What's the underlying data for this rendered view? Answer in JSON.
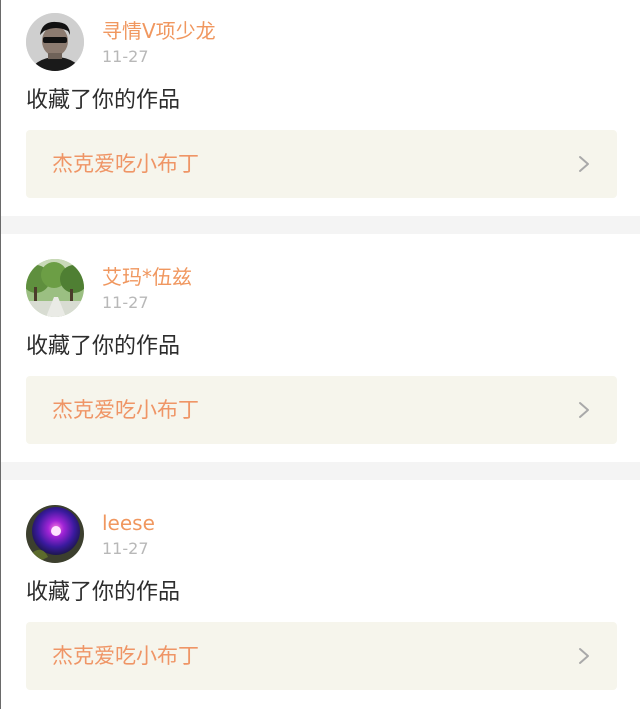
{
  "notifications": [
    {
      "username": "寻情V项少龙",
      "time": "11-27",
      "action": "收藏了你的作品",
      "work_title": "杰克爱吃小布丁",
      "avatar_icon": "person-avatar-icon"
    },
    {
      "username": "艾玛*伍兹",
      "time": "11-27",
      "action": "收藏了你的作品",
      "work_title": "杰克爱吃小布丁",
      "avatar_icon": "trees-avatar-icon"
    },
    {
      "username": "leese",
      "time": "11-27",
      "action": "收藏了你的作品",
      "work_title": "杰克爱吃小布丁",
      "avatar_icon": "flower-avatar-icon"
    }
  ],
  "colors": {
    "username": "#f0975f",
    "work_title": "#ef9566",
    "work_box_bg": "#f6f5ec",
    "time": "#b8b8b8",
    "divider": "#f4f4f4"
  }
}
